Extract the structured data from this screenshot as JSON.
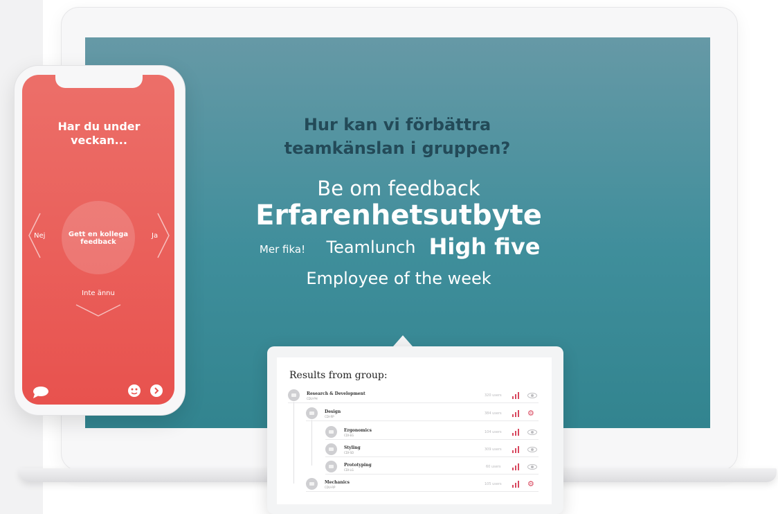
{
  "laptop": {
    "question_line1": "Hur kan vi förbättra",
    "question_line2": "teamkänslan i gruppen?",
    "words": {
      "w1": "Be om feedback",
      "w2": "Erfarenhetsutbyte",
      "w3": "Mer fika!",
      "w4": "Teamlunch",
      "w5": "High five",
      "w6": "Employee of the week"
    }
  },
  "phone": {
    "title_line1": "Har du under",
    "title_line2": "veckan...",
    "center_line1": "Gett en kollega",
    "center_line2": "feedback",
    "left_label": "Nej",
    "right_label": "Ja",
    "bottom_label": "Inte ännu",
    "icons": [
      "chat-bubble-icon",
      "smiley-icon",
      "arrow-right-icon",
      "chevron-left-icon",
      "chevron-right-icon",
      "chevron-down-icon"
    ]
  },
  "results": {
    "title": "Results from group:",
    "rows": [
      {
        "name": "Research & Development",
        "code": "CDU-PH",
        "users": "320 users",
        "action": "eye"
      },
      {
        "name": "Design",
        "code": "CDI-RP",
        "users": "384 users",
        "action": "gear"
      },
      {
        "name": "Ergonomics",
        "code": "CDI-EG",
        "users": "104 users",
        "action": "eye"
      },
      {
        "name": "Styling",
        "code": "CDI-SD",
        "users": "309 users",
        "action": "eye"
      },
      {
        "name": "Prototyping",
        "code": "CDI-LG",
        "users": "60 users",
        "action": "eye"
      },
      {
        "name": "Mechanics",
        "code": "CDU-RP",
        "users": "105 users",
        "action": "gear"
      }
    ]
  },
  "colors": {
    "screen_teal": "#3f8e9b",
    "question_text": "#234a58",
    "phone_red": "#e8524e",
    "accent_pink": "#d8475e"
  }
}
